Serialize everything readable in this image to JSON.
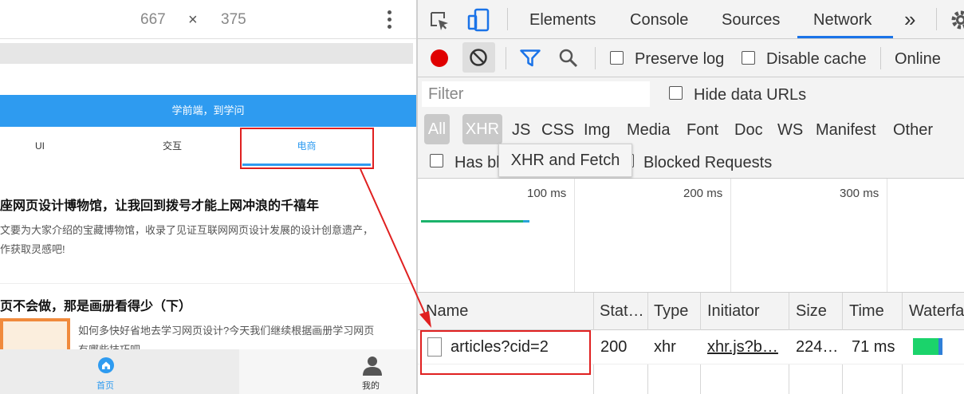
{
  "device": {
    "width": "667",
    "times": "×",
    "height": "375"
  },
  "page": {
    "banner": "学前端，到学问",
    "tabs": [
      "UI",
      "交互",
      "电商"
    ],
    "articles": [
      {
        "title": "座网页设计博物馆，让我回到拨号才能上网冲浪的千禧年",
        "desc1": "文要为大家介绍的宝藏博物馆，收录了见证互联网网页设计发展的设计创意遗产，",
        "desc2": "作获取灵感吧!"
      },
      {
        "title": "页不会做，那是画册看得少（下）",
        "desc1": "如何多快好省地去学习网页设计?今天我们继续根据画册学习网页",
        "desc2": "有哪些技巧吧"
      }
    ],
    "nav": {
      "home": "首页",
      "me": "我的"
    }
  },
  "devtools": {
    "tabs": [
      "Elements",
      "Console",
      "Sources",
      "Network"
    ],
    "more": "»",
    "toolbar": {
      "preserve_log": "Preserve log",
      "disable_cache": "Disable cache",
      "online": "Online"
    },
    "filter_placeholder": "Filter",
    "hide_data_urls": "Hide data URLs",
    "types": [
      "All",
      "XHR",
      "JS",
      "CSS",
      "Img",
      "Media",
      "Font",
      "Doc",
      "WS",
      "Manifest",
      "Other"
    ],
    "has_blocked": "Has bl",
    "blocked_requests": "Blocked Requests",
    "tooltip": "XHR and Fetch",
    "timeline": [
      "100 ms",
      "200 ms",
      "300 ms"
    ],
    "columns": [
      "Name",
      "Stat…",
      "Type",
      "Initiator",
      "Size",
      "Time",
      "Waterfa"
    ],
    "row": {
      "name": "articles?cid=2",
      "status": "200",
      "type": "xhr",
      "initiator": "xhr.js?b…",
      "size": "224…",
      "time": "71 ms"
    }
  },
  "colors": {
    "accent": "#2e9bf0",
    "record": "#e00000",
    "network_tab": "#1a73e8",
    "highlight": "#e02020"
  }
}
